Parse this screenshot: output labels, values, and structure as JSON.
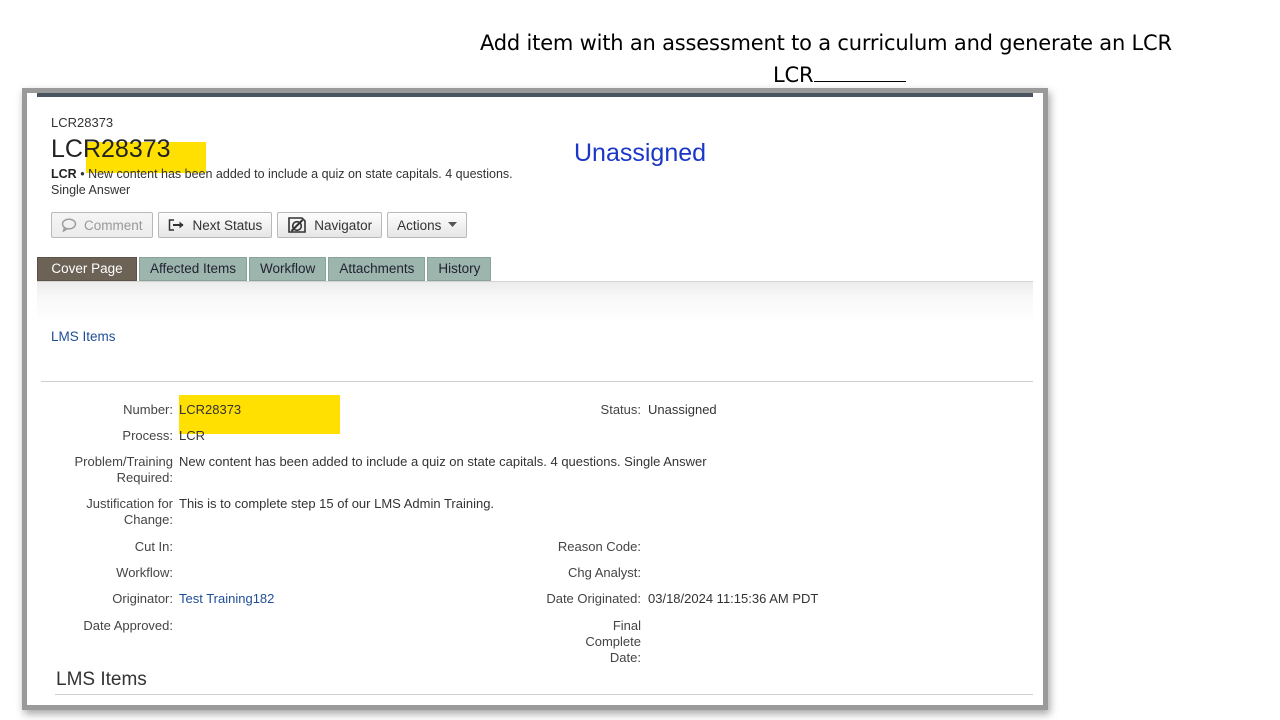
{
  "slide": {
    "title": "Add item with an assessment to a curriculum and generate an LCR",
    "subtitle": "LCR"
  },
  "record": {
    "breadcrumb": "LCR28373",
    "id": "LCR28373",
    "type": "LCR",
    "bullet": "•",
    "description": "New content has been added to include a quiz on state capitals.  4 questions. Single Answer",
    "status": "Unassigned"
  },
  "toolbar": {
    "comment": "Comment",
    "next_status": "Next Status",
    "navigator": "Navigator",
    "actions": "Actions"
  },
  "tabs": [
    {
      "label": "Cover Page",
      "active": true
    },
    {
      "label": "Affected Items",
      "active": false
    },
    {
      "label": "Workflow",
      "active": false
    },
    {
      "label": "Attachments",
      "active": false
    },
    {
      "label": "History",
      "active": false
    }
  ],
  "band_link": "LMS Items",
  "fields": {
    "number_label": "Number:",
    "number": "LCR28373",
    "status_label": "Status:",
    "status": "Unassigned",
    "process_label": "Process:",
    "process": "LCR",
    "problem_label": "Problem/Training Required:",
    "problem": "New content has been added to include a quiz on state capitals.  4 questions. Single Answer",
    "justification_label": "Justification for Change:",
    "justification": "This is to complete step 15 of our LMS Admin Training.",
    "cut_in_label": "Cut In:",
    "reason_code_label": "Reason Code:",
    "workflow_label": "Workflow:",
    "chg_analyst_label": "Chg Analyst:",
    "originator_label": "Originator:",
    "originator": "Test Training182",
    "date_originated_label": "Date Originated:",
    "date_originated": "03/18/2024 11:15:36 AM PDT",
    "date_approved_label": "Date Approved:",
    "final_complete_label": "Final Complete Date:"
  },
  "section_title": "LMS Items",
  "colors": {
    "highlight": "#ffe000",
    "status_blue": "#1a37c8",
    "link_blue": "#1f4e96",
    "tab_active": "#6c6256",
    "tab_inactive": "#9db6ad"
  }
}
